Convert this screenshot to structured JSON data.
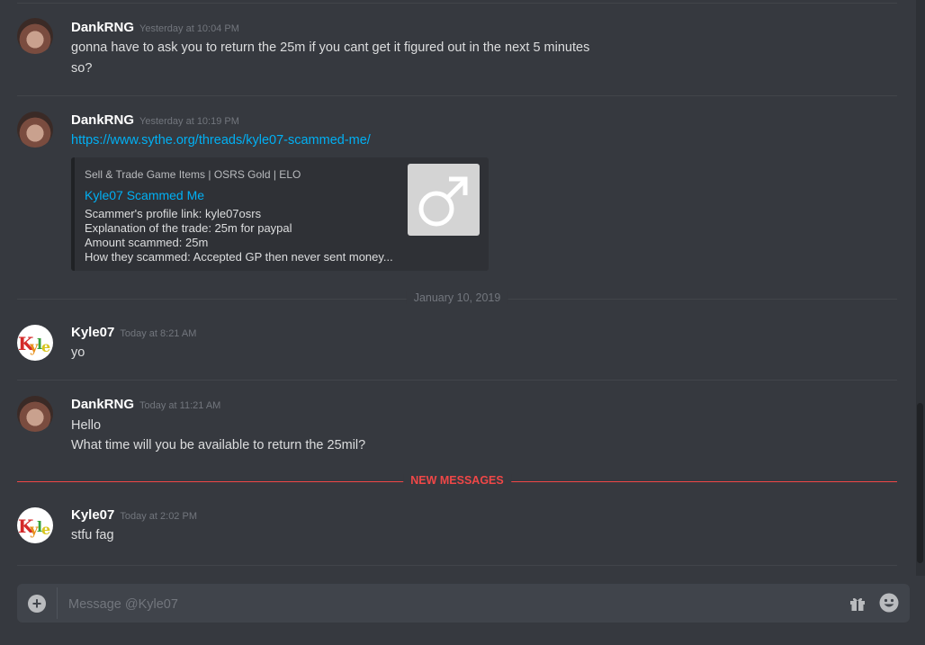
{
  "messages": [
    {
      "author": "DankRNG",
      "timestamp": "Yesterday at 10:04 PM",
      "avatar": "dank-avatar",
      "lines": [
        "gonna have to ask you to return the 25m if you cant get it figured out in the next 5 minutes",
        "so?"
      ]
    },
    {
      "author": "DankRNG",
      "timestamp": "Yesterday at 10:19 PM",
      "avatar": "dank-avatar",
      "link": "https://www.sythe.org/threads/kyle07-scammed-me/",
      "embed": {
        "provider": "Sell & Trade Game Items | OSRS Gold | ELO",
        "title": "Kyle07 Scammed Me",
        "description": [
          "Scammer's profile link: kyle07osrs",
          "Explanation of the trade: 25m for paypal",
          "Amount scammed: 25m",
          "How they scammed: Accepted GP then never sent money..."
        ],
        "thumbnail_icon": "male-symbol-icon"
      }
    },
    {
      "author": "Kyle07",
      "timestamp": "Today at 8:21 AM",
      "avatar": "kyle-avatar",
      "lines": [
        "yo"
      ]
    },
    {
      "author": "DankRNG",
      "timestamp": "Today at 11:21 AM",
      "avatar": "dank-avatar",
      "lines": [
        "Hello",
        "What time will you be available to return the 25mil?"
      ]
    },
    {
      "author": "Kyle07",
      "timestamp": "Today at 2:02 PM",
      "avatar": "kyle-avatar",
      "lines": [
        "stfu fag"
      ]
    }
  ],
  "date_separator": "January 10, 2019",
  "new_messages_label": "NEW MESSAGES",
  "composer": {
    "placeholder": "Message @Kyle07",
    "plus_icon": "plus-circle-icon",
    "gift_icon": "gift-icon",
    "emoji_icon": "emoji-icon"
  },
  "colors": {
    "background": "#36393f",
    "link": "#00b0f4",
    "new_messages": "#f04747",
    "username": "#ffffff",
    "timestamp": "#72767d"
  }
}
